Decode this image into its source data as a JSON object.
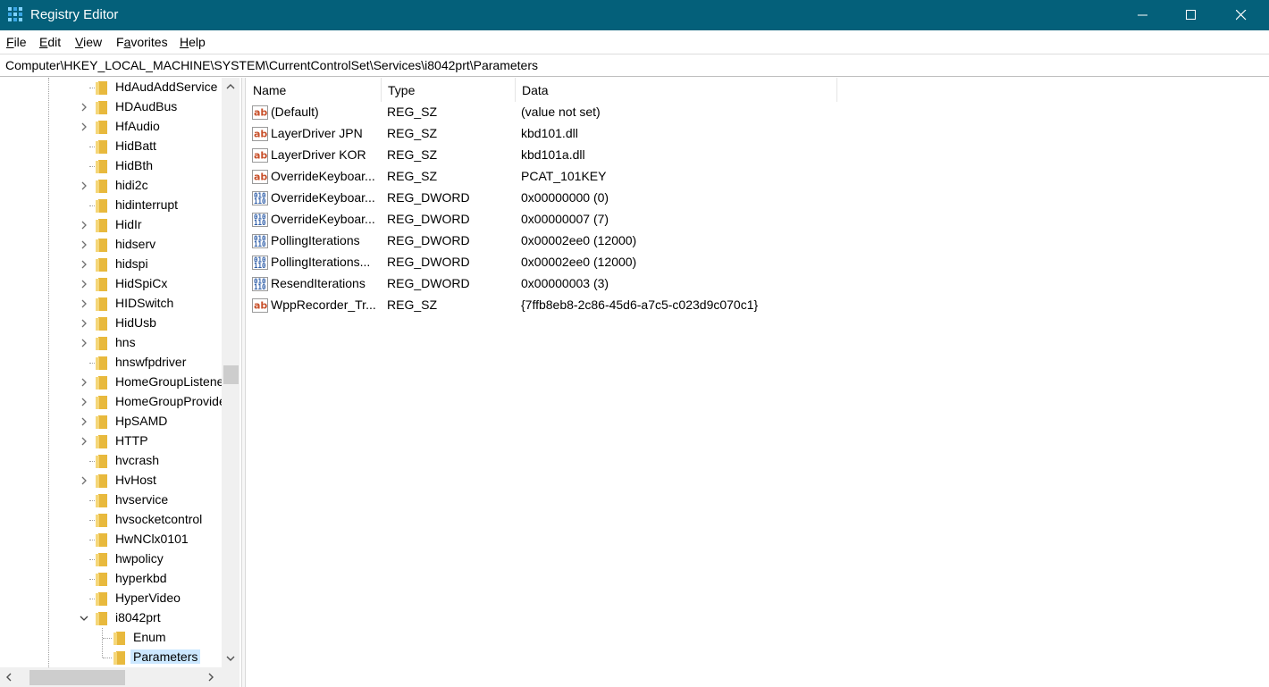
{
  "window": {
    "title": "Registry Editor",
    "icon": "registry-editor-icon",
    "accent": "#04607a"
  },
  "menu": [
    "File",
    "Edit",
    "View",
    "Favorites",
    "Help"
  ],
  "menu_mnemonics": [
    "F",
    "E",
    "V",
    "a",
    "H"
  ],
  "address": "Computer\\HKEY_LOCAL_MACHINE\\SYSTEM\\CurrentControlSet\\Services\\i8042prt\\Parameters",
  "tree": {
    "items": [
      {
        "label": "HdAudAddService",
        "expandable": false
      },
      {
        "label": "HDAudBus",
        "expandable": true
      },
      {
        "label": "HfAudio",
        "expandable": true
      },
      {
        "label": "HidBatt",
        "expandable": false
      },
      {
        "label": "HidBth",
        "expandable": false
      },
      {
        "label": "hidi2c",
        "expandable": true
      },
      {
        "label": "hidinterrupt",
        "expandable": false
      },
      {
        "label": "HidIr",
        "expandable": true
      },
      {
        "label": "hidserv",
        "expandable": true
      },
      {
        "label": "hidspi",
        "expandable": true
      },
      {
        "label": "HidSpiCx",
        "expandable": true
      },
      {
        "label": "HIDSwitch",
        "expandable": true
      },
      {
        "label": "HidUsb",
        "expandable": true
      },
      {
        "label": "hns",
        "expandable": true
      },
      {
        "label": "hnswfpdriver",
        "expandable": false
      },
      {
        "label": "HomeGroupListener",
        "expandable": true
      },
      {
        "label": "HomeGroupProvider",
        "expandable": true
      },
      {
        "label": "HpSAMD",
        "expandable": true
      },
      {
        "label": "HTTP",
        "expandable": true
      },
      {
        "label": "hvcrash",
        "expandable": false
      },
      {
        "label": "HvHost",
        "expandable": true
      },
      {
        "label": "hvservice",
        "expandable": false
      },
      {
        "label": "hvsocketcontrol",
        "expandable": false
      },
      {
        "label": "HwNClx0101",
        "expandable": false
      },
      {
        "label": "hwpolicy",
        "expandable": false
      },
      {
        "label": "hyperkbd",
        "expandable": false
      },
      {
        "label": "HyperVideo",
        "expandable": false
      },
      {
        "label": "i8042prt",
        "expandable": true,
        "expanded": true
      }
    ],
    "children": [
      {
        "label": "Enum"
      },
      {
        "label": "Parameters",
        "selected": true
      }
    ]
  },
  "list": {
    "columns": [
      "Name",
      "Type",
      "Data"
    ],
    "rows": [
      {
        "icon": "string-value-icon",
        "name": "(Default)",
        "type": "REG_SZ",
        "data": "(value not set)"
      },
      {
        "icon": "string-value-icon",
        "name": "LayerDriver JPN",
        "type": "REG_SZ",
        "data": "kbd101.dll"
      },
      {
        "icon": "string-value-icon",
        "name": "LayerDriver KOR",
        "type": "REG_SZ",
        "data": "kbd101a.dll"
      },
      {
        "icon": "string-value-icon",
        "name": "OverrideKeyboar...",
        "type": "REG_SZ",
        "data": "PCAT_101KEY"
      },
      {
        "icon": "dword-value-icon",
        "name": "OverrideKeyboar...",
        "type": "REG_DWORD",
        "data": "0x00000000 (0)"
      },
      {
        "icon": "dword-value-icon",
        "name": "OverrideKeyboar...",
        "type": "REG_DWORD",
        "data": "0x00000007 (7)"
      },
      {
        "icon": "dword-value-icon",
        "name": "PollingIterations",
        "type": "REG_DWORD",
        "data": "0x00002ee0 (12000)"
      },
      {
        "icon": "dword-value-icon",
        "name": "PollingIterations...",
        "type": "REG_DWORD",
        "data": "0x00002ee0 (12000)"
      },
      {
        "icon": "dword-value-icon",
        "name": "ResendIterations",
        "type": "REG_DWORD",
        "data": "0x00000003 (3)"
      },
      {
        "icon": "string-value-icon",
        "name": "WppRecorder_Tr...",
        "type": "REG_SZ",
        "data": "{7ffb8eb8-2c86-45d6-a7c5-c023d9c070c1}"
      }
    ]
  },
  "colors": {
    "selection": "#cce8ff",
    "folder": "#e8b93d",
    "string_icon": "#c8502a",
    "dword_icon": "#2f5ea8"
  }
}
